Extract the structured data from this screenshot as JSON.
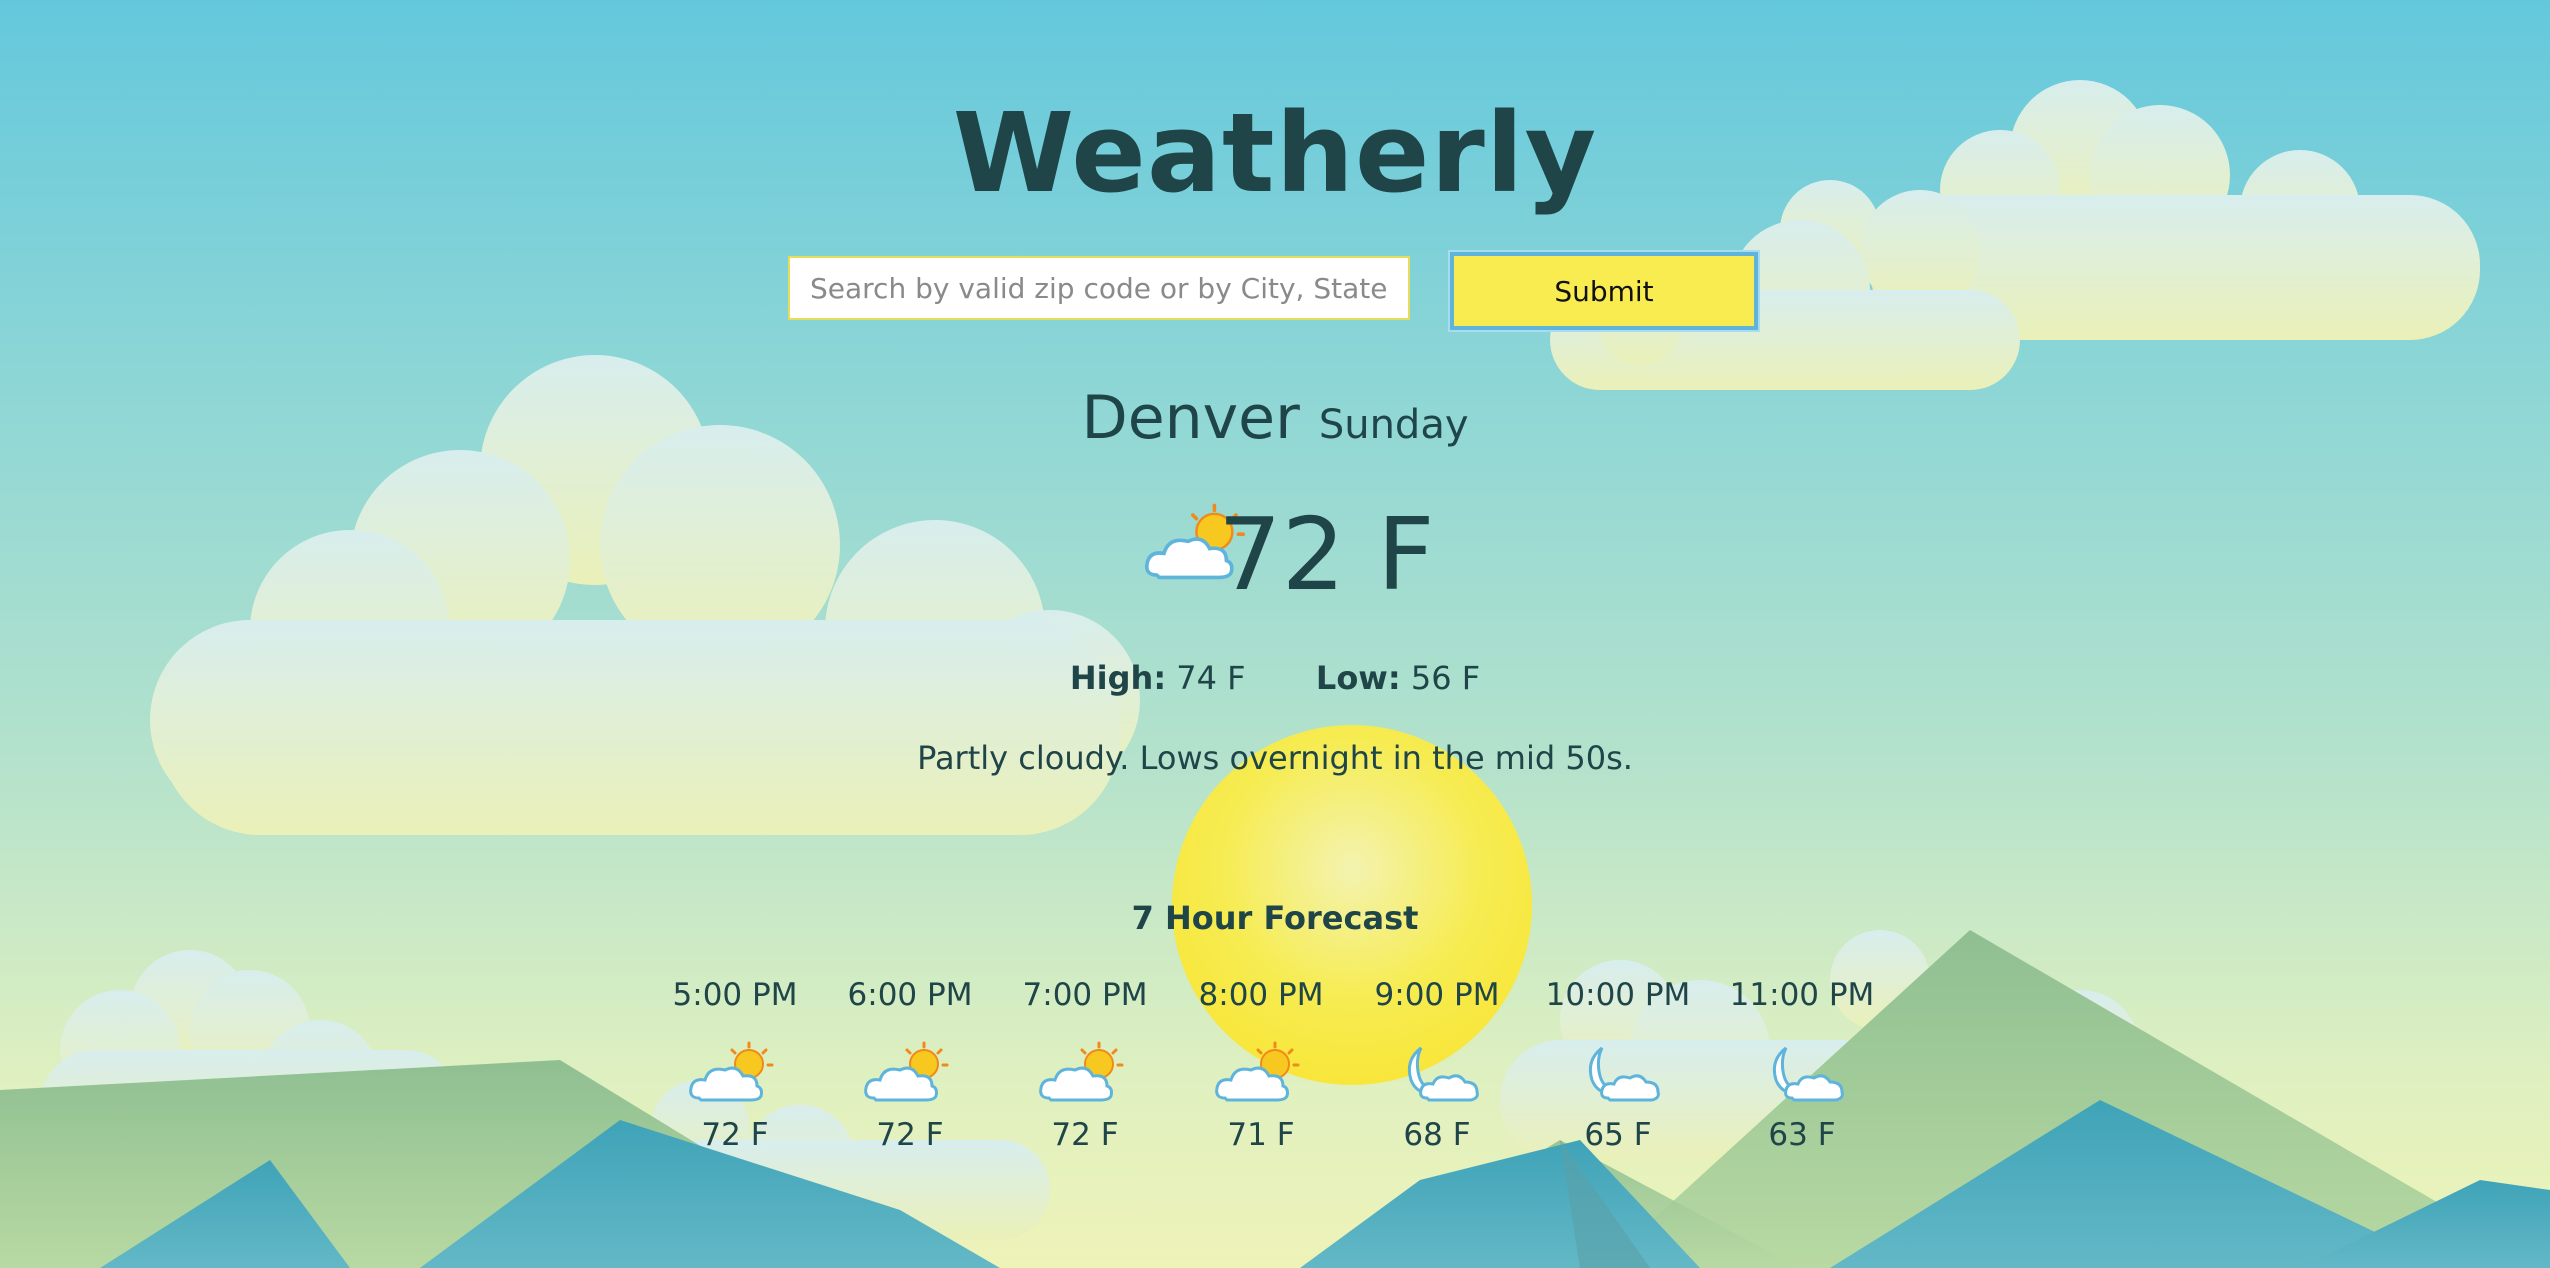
{
  "app": {
    "title": "Weatherly"
  },
  "search": {
    "placeholder": "Search by valid zip code or by City, State",
    "submit_label": "Submit"
  },
  "current": {
    "city": "Denver",
    "day": "Sunday",
    "icon": "partly-cloudy-day-icon",
    "temp": "72 F",
    "high_label": "High:",
    "high": "74 F",
    "low_label": "Low:",
    "low": "56 F",
    "description": "Partly cloudy. Lows overnight in the mid 50s."
  },
  "forecast": {
    "title": "7 Hour Forecast",
    "hours": [
      {
        "time": "5:00 PM",
        "temp": "72 F",
        "icon": "partly-cloudy-day-icon"
      },
      {
        "time": "6:00 PM",
        "temp": "72 F",
        "icon": "partly-cloudy-day-icon"
      },
      {
        "time": "7:00 PM",
        "temp": "72 F",
        "icon": "partly-cloudy-day-icon"
      },
      {
        "time": "8:00 PM",
        "temp": "71 F",
        "icon": "partly-cloudy-day-icon"
      },
      {
        "time": "9:00 PM",
        "temp": "68 F",
        "icon": "partly-cloudy-night-icon"
      },
      {
        "time": "10:00 PM",
        "temp": "65 F",
        "icon": "partly-cloudy-night-icon"
      },
      {
        "time": "11:00 PM",
        "temp": "63 F",
        "icon": "partly-cloudy-night-icon"
      }
    ]
  },
  "colors": {
    "text": "#1f4548",
    "accent_yellow": "#f8ec50",
    "sky_top": "#64c8dc",
    "sky_bottom": "#eef3b8",
    "button_border": "#5fb4dc"
  }
}
